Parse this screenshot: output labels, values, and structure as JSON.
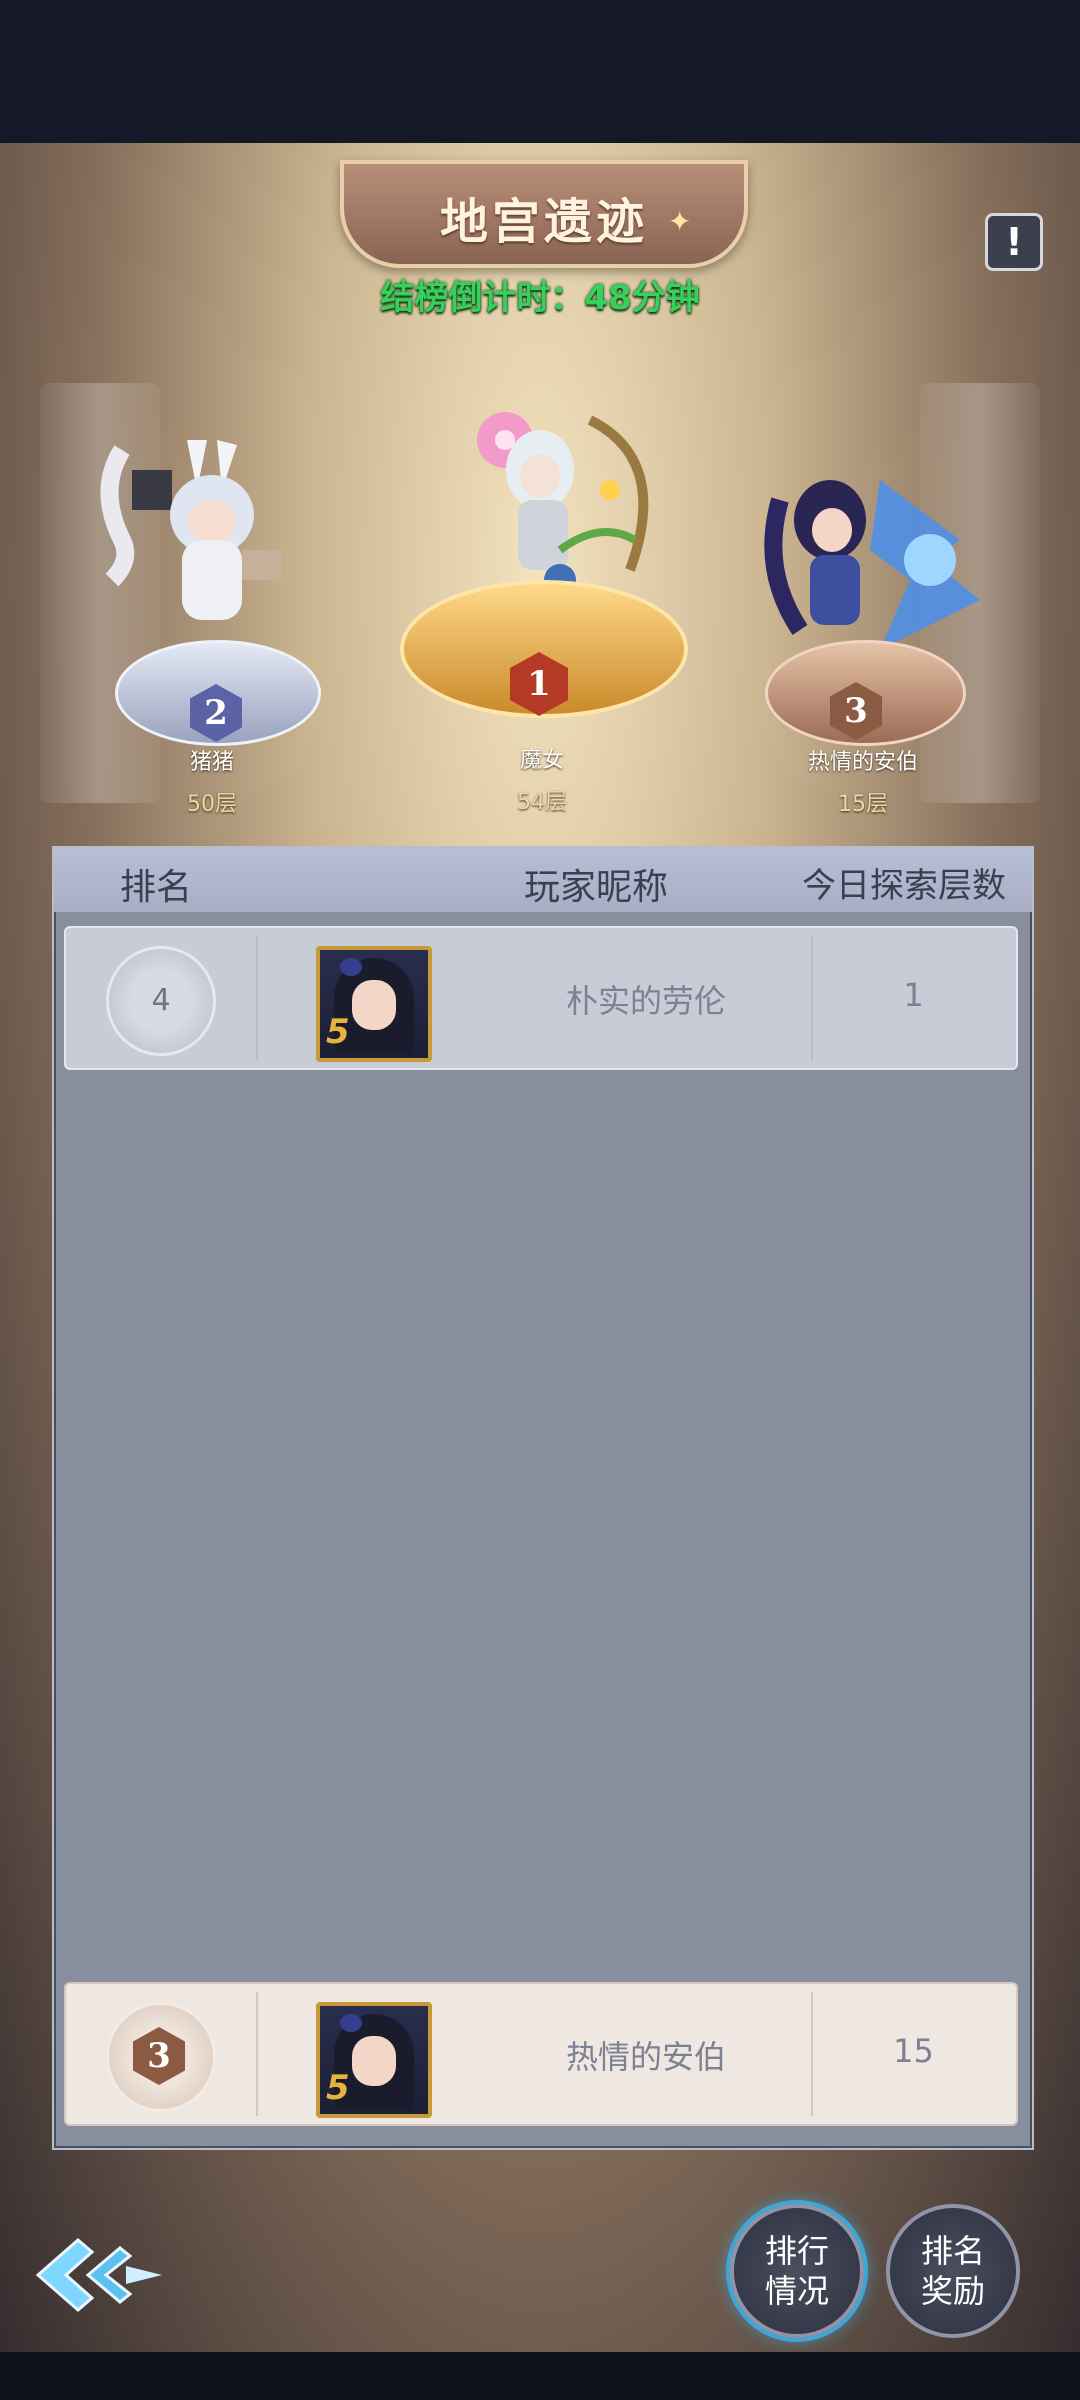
{
  "header": {
    "title": "地宫遗迹",
    "countdown_label": "结榜倒计时：48分钟",
    "info_symbol": "!"
  },
  "podium": [
    {
      "rank": "2",
      "name": "猪猪",
      "floor": "50层"
    },
    {
      "rank": "1",
      "name": "魔女",
      "floor": "54层"
    },
    {
      "rank": "3",
      "name": "热情的安伯",
      "floor": "15层"
    }
  ],
  "table": {
    "headers": {
      "rank": "排名",
      "nickname": "玩家昵称",
      "floors": "今日探索层数"
    },
    "rows": [
      {
        "rank": "4",
        "name": "朴实的劳伦",
        "floors": "1"
      }
    ],
    "self": {
      "rank": "3",
      "name": "热情的安伯",
      "floors": "15"
    }
  },
  "buttons": {
    "ranking_line1": "排行",
    "ranking_line2": "情况",
    "reward_line1": "排名",
    "reward_line2": "奖励"
  },
  "avatar_badge": "5"
}
